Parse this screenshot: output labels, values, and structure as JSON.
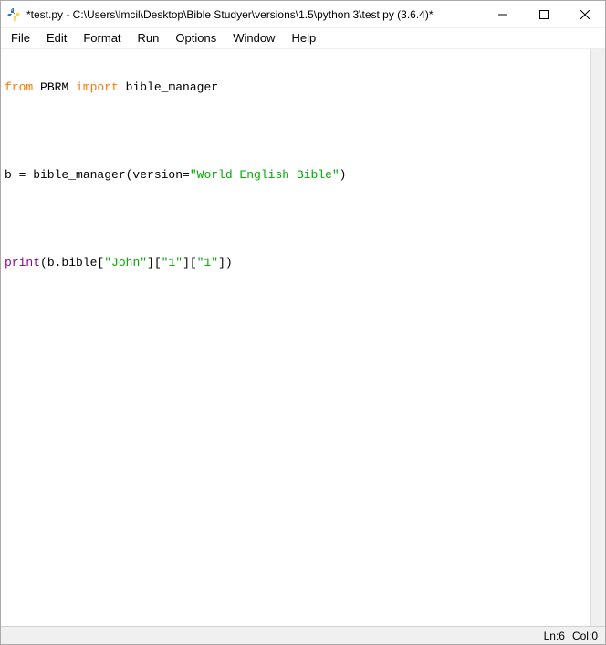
{
  "window": {
    "title": "*test.py - C:\\Users\\lmcil\\Desktop\\Bible Studyer\\versions\\1.5\\python 3\\test.py (3.6.4)*"
  },
  "menu": {
    "items": [
      "File",
      "Edit",
      "Format",
      "Run",
      "Options",
      "Window",
      "Help"
    ]
  },
  "code": {
    "line1": {
      "t1": "from",
      "t2": " PBRM ",
      "t3": "import",
      "t4": " bible_manager"
    },
    "line2": "",
    "line3": {
      "t1": "b = bible_manager(version=",
      "t2": "\"World English Bible\"",
      "t3": ")"
    },
    "line4": "",
    "line5": {
      "t1": "print",
      "t2": "(b.bible[",
      "t3": "\"John\"",
      "t4": "][",
      "t5": "\"1\"",
      "t6": "][",
      "t7": "\"1\"",
      "t8": "])"
    }
  },
  "status": {
    "line_label": "Ln:",
    "line_value": "6",
    "col_label": "Col:",
    "col_value": "0"
  }
}
